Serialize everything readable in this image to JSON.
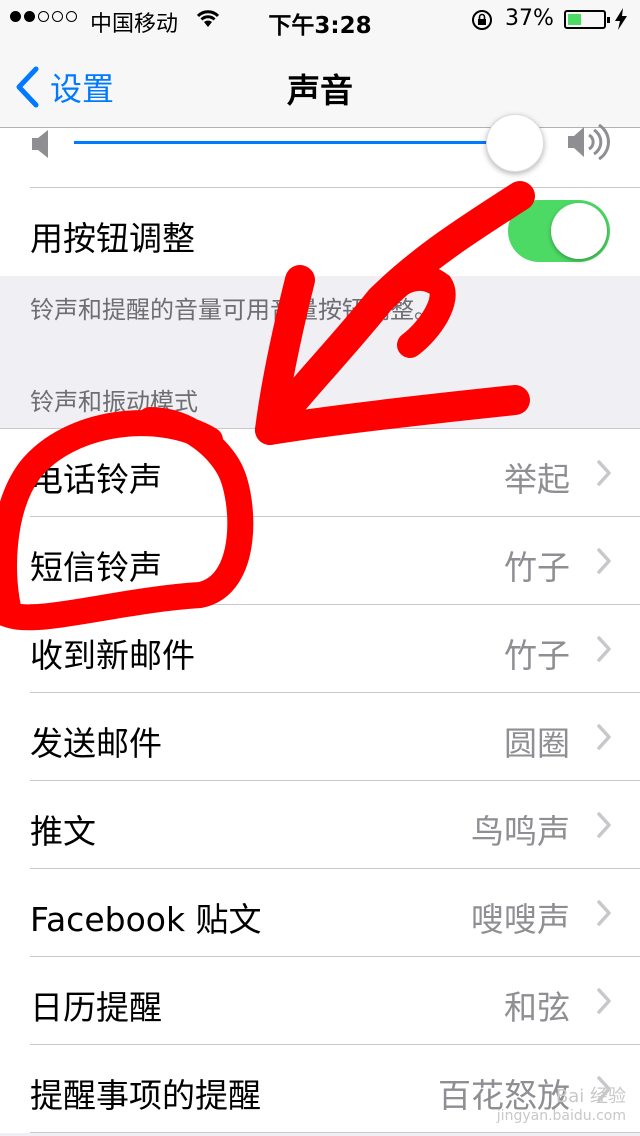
{
  "status_bar": {
    "carrier": "中国移动",
    "time": "下午3:28",
    "battery_percent_text": "37%",
    "battery_level": 0.37,
    "signal_bars": 2
  },
  "nav": {
    "back_label": "设置",
    "title": "声音"
  },
  "volume": {
    "level": 0.95
  },
  "adjust_with_buttons": {
    "label": "用按钮调整",
    "enabled": true
  },
  "footer_note": "铃声和提醒的音量可用音量按钮调整。",
  "section_header": "铃声和振动模式",
  "sound_rows": [
    {
      "label": "电话铃声",
      "value": "举起"
    },
    {
      "label": "短信铃声",
      "value": "竹子"
    },
    {
      "label": "收到新邮件",
      "value": "竹子"
    },
    {
      "label": "发送邮件",
      "value": "圆圈"
    },
    {
      "label": "推文",
      "value": "鸟鸣声"
    },
    {
      "label": "Facebook 贴文",
      "value": "嗖嗖声"
    },
    {
      "label": "日历提醒",
      "value": "和弦"
    },
    {
      "label": "提醒事项的提醒",
      "value": "百花怒放"
    }
  ],
  "colors": {
    "accent": "#007aff",
    "toggle_on": "#4cd964",
    "annotation": "#ff0000"
  },
  "watermark": {
    "line1": "Bai 经验",
    "line2": "jingyan.baidu.com"
  }
}
